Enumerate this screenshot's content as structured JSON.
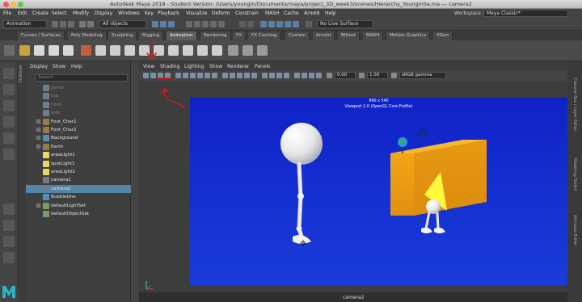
{
  "window": {
    "title": "Autodesk Maya 2018 - Student Version: /Users/youngin/Documents/maya/project_3D_week3/scenes/Hierarchy_YounginSa.ma   ---   camera2"
  },
  "menubar": {
    "items": [
      "File",
      "Edit",
      "Create",
      "Select",
      "Modify",
      "Display",
      "Windows",
      "Key",
      "Playback",
      "Visualize",
      "Deform",
      "Constrain",
      "MASH",
      "Cache",
      "Arnold",
      "Help"
    ],
    "workspace_label": "Workspace :",
    "workspace_value": "Maya Classic*"
  },
  "statusline": {
    "mode": "Animation",
    "object_filter": "All objects",
    "live_surface": "No Live Surface"
  },
  "shelf_tabs": [
    "Curves / Surfaces",
    "Poly Modeling",
    "Sculpting",
    "Rigging",
    "Animation",
    "Rendering",
    "FX",
    "FX Caching",
    "Custom",
    "Arnold",
    "Bifrost",
    "MASH",
    "Motion Graphics",
    "XGen"
  ],
  "shelf_active": "Animation",
  "outliner": {
    "strip_label": "Outliner",
    "menu": [
      "Display",
      "Show",
      "Help"
    ],
    "search_placeholder": "Search...",
    "items": [
      {
        "label": "persp",
        "dim": true,
        "expandable": false,
        "icon": "camera-icon",
        "selected": false
      },
      {
        "label": "top",
        "dim": true,
        "expandable": false,
        "icon": "camera-icon",
        "selected": false
      },
      {
        "label": "front",
        "dim": true,
        "expandable": false,
        "icon": "camera-icon",
        "selected": false
      },
      {
        "label": "side",
        "dim": true,
        "expandable": false,
        "icon": "camera-icon",
        "selected": false
      },
      {
        "label": "Foot_Char1",
        "dim": false,
        "expandable": true,
        "icon": "joint-icon",
        "selected": false
      },
      {
        "label": "Foot_Char2",
        "dim": false,
        "expandable": true,
        "icon": "joint-icon",
        "selected": false
      },
      {
        "label": "Background",
        "dim": false,
        "expandable": true,
        "icon": "mesh-icon",
        "selected": false
      },
      {
        "label": "Earth",
        "dim": false,
        "expandable": true,
        "icon": "joint-icon",
        "selected": false
      },
      {
        "label": "areaLight1",
        "dim": false,
        "expandable": false,
        "icon": "light-icon",
        "selected": false
      },
      {
        "label": "spotLight1",
        "dim": false,
        "expandable": false,
        "icon": "light-icon",
        "selected": false
      },
      {
        "label": "areaLight2",
        "dim": false,
        "expandable": false,
        "icon": "light-icon",
        "selected": false
      },
      {
        "label": "camera1",
        "dim": false,
        "expandable": false,
        "icon": "camera-icon",
        "selected": false
      },
      {
        "label": "camera2",
        "dim": false,
        "expandable": false,
        "icon": "camera-icon",
        "selected": true
      },
      {
        "label": "BubbleOne",
        "dim": false,
        "expandable": false,
        "icon": "mesh-icon",
        "selected": false
      },
      {
        "label": "defaultLightSet",
        "dim": false,
        "expandable": true,
        "icon": "set-icon",
        "selected": false
      },
      {
        "label": "defaultObjectSet",
        "dim": false,
        "expandable": false,
        "icon": "set-icon",
        "selected": false
      }
    ]
  },
  "panel": {
    "menu": [
      "View",
      "Shading",
      "Lighting",
      "Show",
      "Renderer",
      "Panels"
    ],
    "field_a": "0.00",
    "field_b": "1.00",
    "color_space": "sRGB gamma",
    "hud_resolution": "960 x 540",
    "hud_renderer": "Viewport 2.0 (OpenGL Core Profile)",
    "camera_label": "camera2"
  },
  "right_strips": [
    "Channel Box / Layer Editor",
    "Modeling Toolkit",
    "Attribute Editor"
  ],
  "colors": {
    "viewport_blue": "#1432d2",
    "box_orange": "#f0a010",
    "selection_blue": "#5285a6",
    "annotation_red": "#e01818"
  }
}
